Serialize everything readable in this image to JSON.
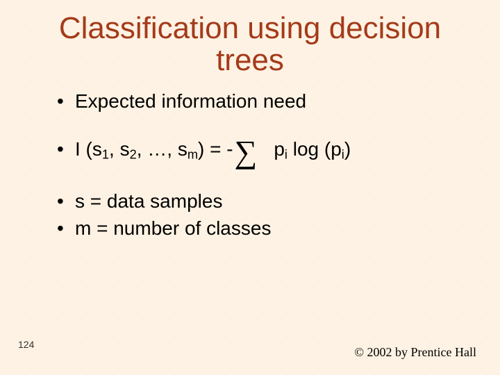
{
  "title": "Classification using decision trees",
  "bullets": {
    "b1": "Expected information need",
    "b2": {
      "prefix": "I (s",
      "sub1": "1",
      "sep1": ", s",
      "sub2": "2",
      "sep2": ", …, s",
      "sub3": "m",
      "mid": ") = -",
      "sigma": "∑",
      "rhs1": "p",
      "rhs_sub1": "i",
      "rhs2": " log (p",
      "rhs_sub2": "i",
      "rhs3": ")"
    },
    "b3": "s = data samples",
    "b4": "m = number of classes"
  },
  "page_number": "124",
  "copyright": "© 2002 by Prentice Hall"
}
